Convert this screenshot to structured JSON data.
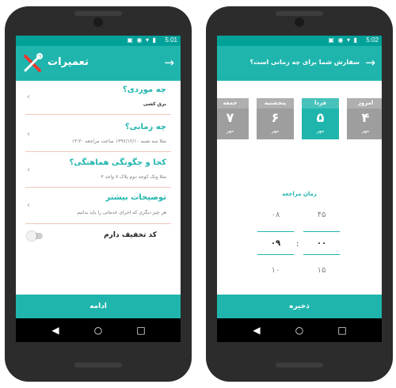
{
  "left": {
    "status_time": "5:01",
    "title": "تعمیرات",
    "items": [
      {
        "question": "چه موردی؟",
        "answer": "برق کشی"
      },
      {
        "question": "چه زمانی؟",
        "answer": "مثلا سه شنبه ۱۳۹۶/۱۲/۱۰ ساعت مراجعه ۱۳:۳۰"
      },
      {
        "question": "کجا و چگونگی هماهنگی؟",
        "answer": "مثلا ونک کوچه دوم پلاک ۷ واحد ۳"
      },
      {
        "question": "توضیحات بیشتر",
        "answer": "هر چیز دیگری که اجرای خدماتی را باید بدانیم"
      }
    ],
    "discount_label": "کد تخفیف دارم",
    "continue_label": "ادامه"
  },
  "right": {
    "status_time": "5:02",
    "title": "سفارش شما برای چه زمانی است؟",
    "days": [
      {
        "name": "جمعه",
        "day": "۷",
        "month": "مهر",
        "selected": false
      },
      {
        "name": "پنجشنبه",
        "day": "۶",
        "month": "مهر",
        "selected": false
      },
      {
        "name": "فردا",
        "day": "۵",
        "month": "مهر",
        "selected": true
      },
      {
        "name": "امروز",
        "day": "۴",
        "month": "مهر",
        "selected": false
      }
    ],
    "time_label": "زمان مراجعه",
    "hours": {
      "above": "۰۸",
      "current": "۰۹",
      "below": "۱۰"
    },
    "minutes": {
      "above": "۴۵",
      "current": "۰۰",
      "below": "۱۵"
    },
    "save_label": "ذخیره"
  },
  "nav": {
    "back": "◀",
    "home": "○",
    "recents": "□"
  },
  "colors": {
    "accent": "#1fb5ad",
    "statusbar": "#00a199",
    "divider": "#f0c9b8",
    "day_inactive": "#9e9e9e"
  }
}
